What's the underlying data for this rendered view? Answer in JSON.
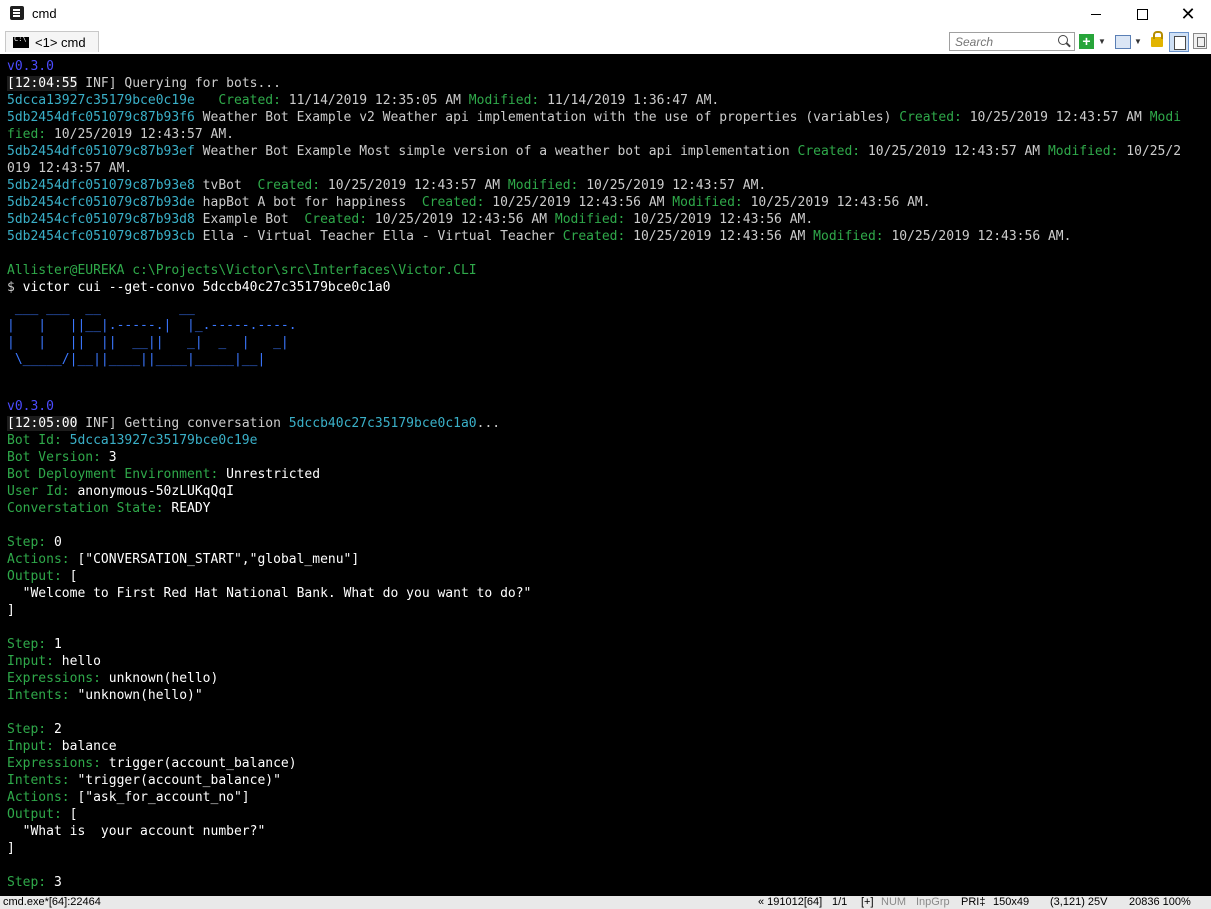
{
  "window": {
    "title": "cmd"
  },
  "tabs": [
    {
      "label": "<1> cmd"
    }
  ],
  "search": {
    "placeholder": "Search"
  },
  "toolbar": {
    "new_console": "+",
    "dropdown": "▼"
  },
  "icons": {
    "app": "console-app-icon",
    "tab": "cmd-prompt-icon",
    "search": "magnifier-icon",
    "new_console": "plus-icon",
    "layout": "panel-icon",
    "lock": "lock-icon",
    "split": "split-view-icon",
    "scroll": "scroll-lock-icon"
  },
  "colors": {
    "version": "#4b4bff",
    "cyan": "#3ab0c8",
    "green": "#2fa94a",
    "text": "#cccccc",
    "background": "#000000",
    "ascii_logo": "#3b78ff"
  },
  "console": {
    "version1": "v0.3.0",
    "log1": {
      "time": "[12:04:55",
      "level": " INF]",
      "message": " Querying for bots..."
    },
    "bots_header": "",
    "bot1": {
      "id": "5dcca13927c35179bce0c19e  ",
      "created_label": " Created:",
      "created": " 11/14/2019 12:35:05 AM",
      "modified_label": " Modified:",
      "modified": " 11/14/2019 1:36:47 AM."
    },
    "bot2a": {
      "id": "5db2454dfc051079c87b93f6",
      "desc": " Weather Bot Example v2 Weather api implementation with the use of properties (variables)",
      "created_label": " Created:",
      "created": " 10/25/2019 12:43:57 AM",
      "modified_label": " Modi"
    },
    "bot2b": {
      "modified_label": "fied:",
      "modified": " 10/25/2019 12:43:57 AM."
    },
    "bot3a": {
      "id": "5db2454dfc051079c87b93ef",
      "desc": " Weather Bot Example Most simple version of a weather bot api implementation",
      "created_label": " Created:",
      "created": " 10/25/2019 12:43:57 AM",
      "modified_label": " Modified:",
      "modified": " 10/25/2"
    },
    "bot3b": {
      "modified": "019 12:43:57 AM."
    },
    "bot4": {
      "id": "5db2454dfc051079c87b93e8",
      "desc": " tvBot ",
      "created_label": " Created:",
      "created": " 10/25/2019 12:43:57 AM",
      "modified_label": " Modified:",
      "modified": " 10/25/2019 12:43:57 AM."
    },
    "bot5": {
      "id": "5db2454cfc051079c87b93de",
      "desc": " hapBot A bot for happiness ",
      "created_label": " Created:",
      "created": " 10/25/2019 12:43:56 AM",
      "modified_label": " Modified:",
      "modified": " 10/25/2019 12:43:56 AM."
    },
    "bot6": {
      "id": "5db2454cfc051079c87b93d8",
      "desc": " Example Bot ",
      "created_label": " Created:",
      "created": " 10/25/2019 12:43:56 AM",
      "modified_label": " Modified:",
      "modified": " 10/25/2019 12:43:56 AM."
    },
    "bot7": {
      "id": "5db2454cfc051079c87b93cb",
      "desc": " Ella - Virtual Teacher Ella - Virtual Teacher",
      "created_label": " Created:",
      "created": " 10/25/2019 12:43:56 AM",
      "modified_label": " Modified:",
      "modified": " 10/25/2019 12:43:56 AM."
    },
    "prompt_path": "Allister@EUREKA c:\\Projects\\Victor\\src\\Interfaces\\Victor.CLI",
    "prompt_symbol": "$",
    "command": " victor cui --get-convo 5dccb40c27c35179bce0c1a0",
    "logo": [
      " ___ ___  __          __",
      "|   |   ||__|.-----.|  |_.-----.----.",
      "|   |   ||  ||  __||   _|  _  |   _|",
      " \\_____/|__||____||____|_____|__|"
    ],
    "version2": "v0.3.0",
    "log2": {
      "time": "[12:05:00",
      "level": " INF]",
      "message": " Getting conversation ",
      "convo_id": "5dccb40c27c35179bce0c1a0",
      "ellipsis": "..."
    },
    "details": [
      {
        "label": "Bot Id:",
        "value": " 5dcca13927c35179bce0c19e"
      },
      {
        "label": "Bot Version:",
        "value": " 3"
      },
      {
        "label": "Bot Deployment Environment:",
        "value": " Unrestricted"
      },
      {
        "label": "User Id:",
        "value": " anonymous-50zLUKqQqI"
      },
      {
        "label": "Converstation State:",
        "value": " READY"
      }
    ],
    "steps": [
      {
        "step": {
          "label": "Step:",
          "value": " 0"
        },
        "actions": {
          "label": "Actions:",
          "value": " [\"CONVERSATION_START\",\"global_menu\"]"
        },
        "output_label": "Output:",
        "output_open": " [",
        "output_text": "  \"Welcome to First Red Hat National Bank. What do you want to do?\"",
        "output_close": "]"
      },
      {
        "step": {
          "label": "Step:",
          "value": " 1"
        },
        "input": {
          "label": "Input:",
          "value": " hello"
        },
        "expressions": {
          "label": "Expressions:",
          "value": " unknown(hello)"
        },
        "intents": {
          "label": "Intents:",
          "value": " \"unknown(hello)\""
        }
      },
      {
        "step": {
          "label": "Step:",
          "value": " 2"
        },
        "input": {
          "label": "Input:",
          "value": " balance"
        },
        "expressions": {
          "label": "Expressions:",
          "value": " trigger(account_balance)"
        },
        "intents": {
          "label": "Intents:",
          "value": " \"trigger(account_balance)\""
        },
        "actions": {
          "label": "Actions:",
          "value": " [\"ask_for_account_no\"]"
        },
        "output_label": "Output:",
        "output_open": " [",
        "output_text": "  \"What is  your account number?\"",
        "output_close": "]"
      },
      {
        "step": {
          "label": "Step:",
          "value": " 3"
        }
      }
    ]
  },
  "statusbar": {
    "process": "cmd.exe*[64]:22464",
    "build": "« 191012[64]",
    "page": "1/1",
    "plus": "[+]",
    "num": "NUM",
    "inpgrp": "InpGrp",
    "pri": "PRI‡",
    "size": "150x49",
    "cursor": "(3,121) 25V",
    "pid": "20836 100%"
  }
}
